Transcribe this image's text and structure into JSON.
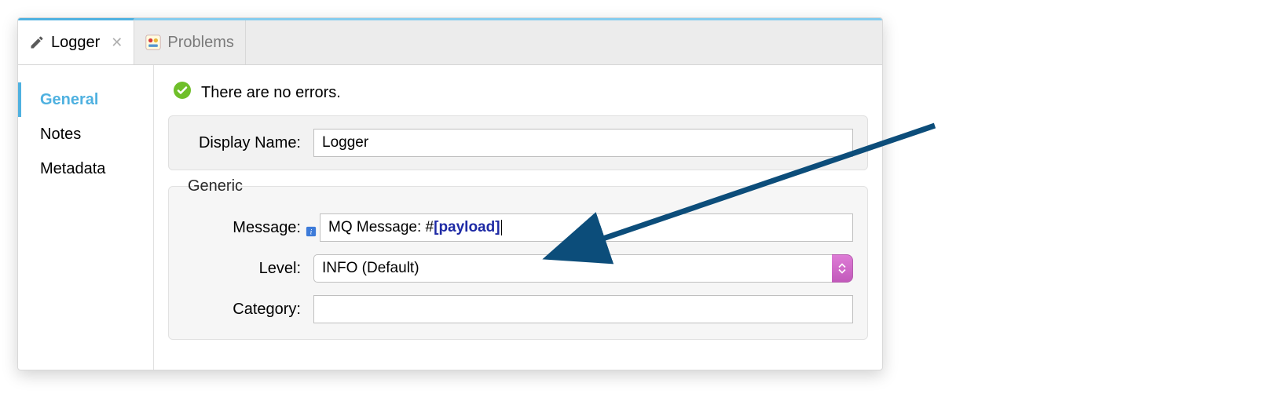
{
  "tabs": [
    {
      "label": "Logger",
      "closable": true
    },
    {
      "label": "Problems",
      "closable": false
    }
  ],
  "sidebar": {
    "items": [
      "General",
      "Notes",
      "Metadata"
    ],
    "selected": 0
  },
  "status": {
    "text": "There are no errors."
  },
  "display_name": {
    "label": "Display Name:",
    "value": "Logger"
  },
  "generic": {
    "legend": "Generic",
    "message": {
      "label": "Message:",
      "prefix": "MQ Message: #",
      "bracket_open": "[",
      "payload": "payload",
      "bracket_close": "]"
    },
    "level": {
      "label": "Level:",
      "value": "INFO (Default)"
    },
    "category": {
      "label": "Category:",
      "value": ""
    }
  }
}
